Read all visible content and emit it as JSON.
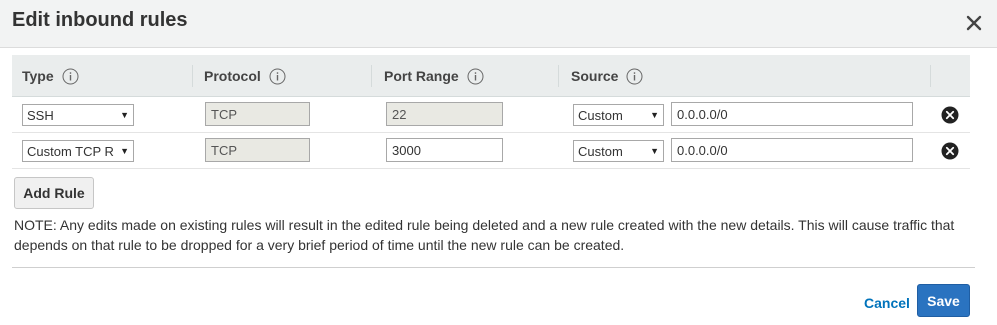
{
  "dialog": {
    "title": "Edit inbound rules",
    "close_icon": "close-icon"
  },
  "columns": [
    {
      "label": "Type",
      "icon": "info-icon"
    },
    {
      "label": "Protocol",
      "icon": "info-icon"
    },
    {
      "label": "Port Range",
      "icon": "info-icon"
    },
    {
      "label": "Source",
      "icon": "info-icon"
    }
  ],
  "rules": [
    {
      "type": "SSH",
      "protocol": "TCP",
      "port_range": "22",
      "port_editable": false,
      "source_type": "Custom",
      "source_value": "0.0.0.0/0",
      "remove_icon": "remove-circle-icon"
    },
    {
      "type": "Custom TCP R",
      "protocol": "TCP",
      "port_range": "3000",
      "port_editable": true,
      "source_type": "Custom",
      "source_value": "0.0.0.0/0",
      "remove_icon": "remove-circle-icon"
    }
  ],
  "add_rule_label": "Add Rule",
  "note": "NOTE: Any edits made on existing rules will result in the edited rule being deleted and a new rule created with the new details. This will cause traffic that depends on that rule to be dropped for a very brief period of time until the new rule can be created.",
  "footer": {
    "cancel_label": "Cancel",
    "save_label": "Save"
  },
  "colors": {
    "primary_button": "#2a73c0",
    "link": "#0073bb",
    "header_bg": "#f2f3f3",
    "table_header_bg": "#eaeded"
  }
}
